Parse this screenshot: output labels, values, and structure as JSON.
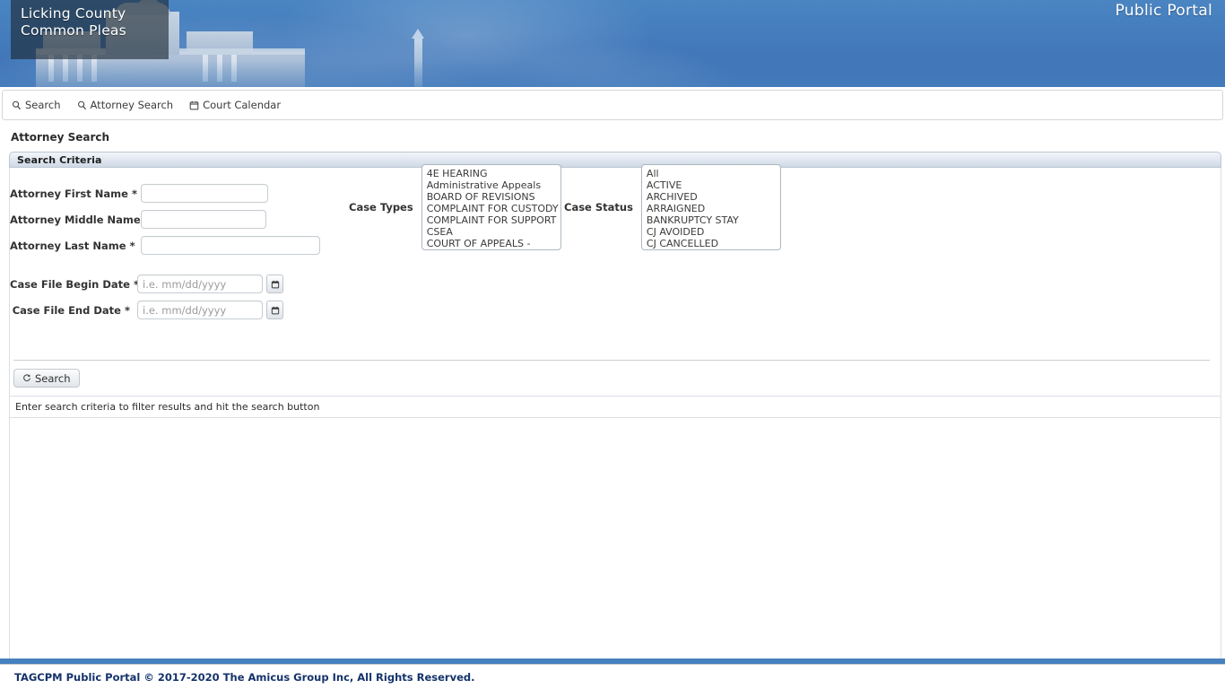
{
  "banner": {
    "title_line1": "Licking County",
    "title_line2": "Common Pleas",
    "portal_label": "Public Portal",
    "accent_color": "#4680bf"
  },
  "nav": {
    "items": [
      {
        "label": "Search",
        "icon": "search-icon"
      },
      {
        "label": "Attorney Search",
        "icon": "search-icon"
      },
      {
        "label": "Court Calendar",
        "icon": "calendar-icon"
      }
    ]
  },
  "page": {
    "title": "Attorney Search"
  },
  "criteria": {
    "section_title": "Search Criteria",
    "fields": {
      "first_name": {
        "label": "Attorney First Name",
        "required": "*",
        "value": "",
        "placeholder": ""
      },
      "middle_name": {
        "label": "Attorney Middle Name",
        "required": "",
        "value": "",
        "placeholder": ""
      },
      "last_name": {
        "label": "Attorney Last Name",
        "required": "*",
        "value": "",
        "placeholder": ""
      },
      "begin_date": {
        "label": "Case File Begin Date",
        "required": "*",
        "value": "",
        "placeholder": "i.e. mm/dd/yyyy"
      },
      "end_date": {
        "label": "Case File End Date",
        "required": "*",
        "value": "",
        "placeholder": "i.e. mm/dd/yyyy"
      }
    },
    "case_types": {
      "label": "Case Types",
      "options": [
        "4E HEARING",
        "Administrative Appeals",
        "BOARD OF REVISIONS",
        "COMPLAINT FOR CUSTODY",
        "COMPLAINT FOR SUPPORT",
        "CSEA",
        "COURT OF APPEALS -"
      ]
    },
    "case_status": {
      "label": "Case Status",
      "options": [
        "All",
        "ACTIVE",
        "ARCHIVED",
        "ARRAIGNED",
        "BANKRUPTCY STAY",
        "CJ AVOIDED",
        "CJ CANCELLED"
      ]
    },
    "search_button": {
      "label": "Search",
      "icon": "refresh-icon"
    }
  },
  "status_message": "Enter search criteria to filter results and hit the search button",
  "footer": {
    "text": "TAGCPM Public Portal  © 2017-2020 The Amicus Group Inc, All Rights Reserved."
  }
}
